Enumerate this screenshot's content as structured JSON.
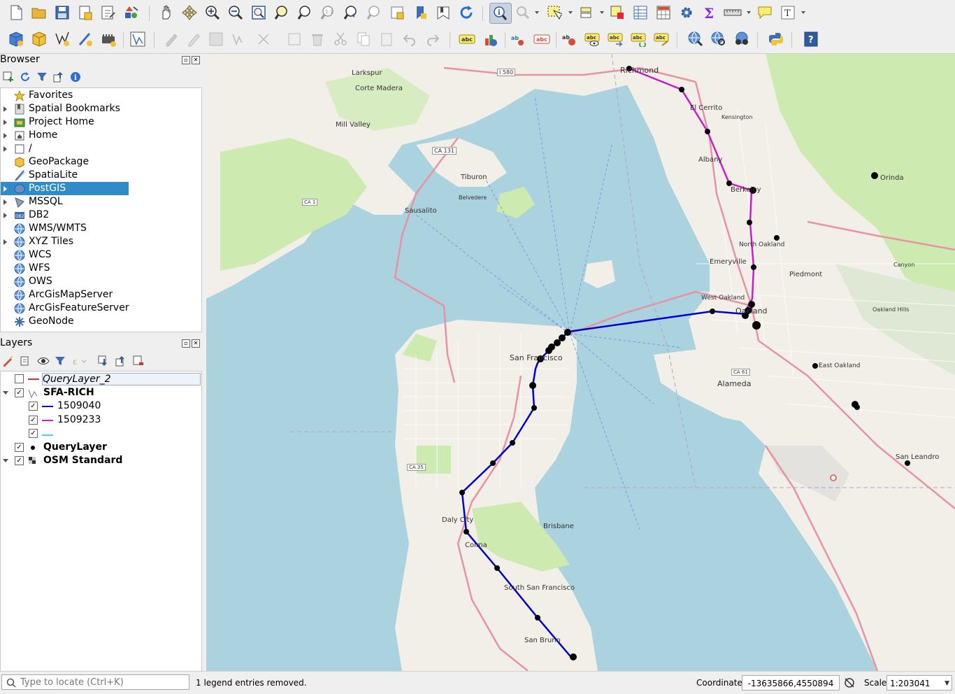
{
  "toolbar_icons": {
    "row1": [
      "new-project-icon",
      "open-project-icon",
      "save-project-icon",
      "new-print-layout-icon",
      "layout-manager-icon",
      "style-manager-icon",
      "pan-icon",
      "pan-to-selection-icon",
      "zoom-in-icon",
      "zoom-out-icon",
      "zoom-full-icon",
      "zoom-to-selection-icon",
      "zoom-to-layer-icon",
      "zoom-native-icon",
      "zoom-last-icon",
      "zoom-next-icon",
      "new-map-view-icon",
      "new-bookmark-icon",
      "show-bookmarks-icon",
      "refresh-icon",
      "identify-icon",
      "map-tips-icon",
      "select-features-icon",
      "select-by-value-icon",
      "deselect-icon",
      "attribute-table-icon",
      "field-calculator-icon",
      "processing-toolbox-icon",
      "statistics-icon",
      "measure-icon",
      "annotation-icon",
      "text-annotation-icon"
    ],
    "row2": [
      "data-source-manager-icon",
      "new-geopackage-layer-icon",
      "new-shapefile-layer-icon",
      "new-spatialite-layer-icon",
      "new-virtual-layer-icon",
      "digitize-icon",
      "current-edits-icon",
      "toggle-editing-icon",
      "save-edits-icon",
      "add-feature-icon",
      "vertex-tool-icon",
      "modify-attributes-icon",
      "delete-selected-icon",
      "cut-features-icon",
      "copy-features-icon",
      "paste-features-icon",
      "undo-icon",
      "redo-icon",
      "label-tool-icon",
      "diagram-icon",
      "pin-label-icon",
      "show-hide-labels-icon",
      "move-label-icon",
      "rotate-label-icon",
      "change-label-icon",
      "label-props-icon",
      "metasearch-icon",
      "wms-icon",
      "coordinate-capture-icon",
      "python-console-icon",
      "help-icon"
    ]
  },
  "browser": {
    "title": "Browser",
    "items": [
      {
        "label": "Favorites",
        "icon": "star-icon",
        "expand": "none"
      },
      {
        "label": "Spatial Bookmarks",
        "icon": "bookmarks-icon",
        "expand": "closed"
      },
      {
        "label": "Project Home",
        "icon": "project-home-icon",
        "expand": "closed"
      },
      {
        "label": "Home",
        "icon": "home-icon",
        "expand": "closed"
      },
      {
        "label": "/",
        "icon": "folder-icon",
        "expand": "closed"
      },
      {
        "label": "GeoPackage",
        "icon": "geopackage-icon",
        "expand": "none"
      },
      {
        "label": "SpatiaLite",
        "icon": "spatialite-icon",
        "expand": "none"
      },
      {
        "label": "PostGIS",
        "icon": "postgis-icon",
        "expand": "closed"
      },
      {
        "label": "MSSQL",
        "icon": "mssql-icon",
        "expand": "closed"
      },
      {
        "label": "DB2",
        "icon": "db2-icon",
        "expand": "closed"
      },
      {
        "label": "WMS/WMTS",
        "icon": "globe-icon",
        "expand": "none"
      },
      {
        "label": "XYZ Tiles",
        "icon": "globe-icon",
        "expand": "closed"
      },
      {
        "label": "WCS",
        "icon": "globe-icon",
        "expand": "none"
      },
      {
        "label": "WFS",
        "icon": "globe-icon",
        "expand": "none"
      },
      {
        "label": "OWS",
        "icon": "globe-icon",
        "expand": "none"
      },
      {
        "label": "ArcGisMapServer",
        "icon": "globe-icon",
        "expand": "none"
      },
      {
        "label": "ArcGisFeatureServer",
        "icon": "globe-icon",
        "expand": "none"
      },
      {
        "label": "GeoNode",
        "icon": "geonode-icon",
        "expand": "none"
      }
    ],
    "selected": "PostGIS"
  },
  "layers": {
    "title": "Layers",
    "items": [
      {
        "label": "QueryLayer_2",
        "checked": false,
        "style": "italic-boxed",
        "symbol": "red-line"
      },
      {
        "label": "SFA-RICH",
        "checked": true,
        "style": "bold",
        "symbol": "line-layer"
      },
      {
        "label": "1509040",
        "checked": true,
        "style": "normal",
        "symbol": "blue-line"
      },
      {
        "label": "1509233",
        "checked": true,
        "style": "normal",
        "symbol": "magenta-line"
      },
      {
        "label": "",
        "checked": true,
        "style": "normal",
        "symbol": "cyan-line"
      },
      {
        "label": "QueryLayer",
        "checked": true,
        "style": "bold",
        "symbol": "black-dot"
      },
      {
        "label": "OSM Standard",
        "checked": true,
        "style": "bold",
        "symbol": "raster-icon"
      }
    ],
    "colors": {
      "blue_route": "#0000cc",
      "magenta_route": "#c81ec8",
      "cyan": "#4fd0e6",
      "red": "#e03030"
    }
  },
  "map": {
    "places": [
      "Richmond",
      "El Cerrito",
      "Kensington",
      "Albany",
      "Berkeley",
      "Orinda",
      "North Oakland",
      "Emeryville",
      "Piedmont",
      "West Oakland",
      "Oakland",
      "Oakland Hills",
      "Larkspur",
      "Corte Madera",
      "Mill Valley",
      "Tiburon",
      "Belvedere",
      "Sausalito",
      "San Francisco",
      "Alameda",
      "East Oakland",
      "San Leandro",
      "Daly City",
      "Colma",
      "Brisbane",
      "South San Francisco",
      "San Bruno",
      "Canyon"
    ],
    "roads": [
      "I 580",
      "CA 131",
      "CA 1",
      "CA 35",
      "CA 61"
    ]
  },
  "status": {
    "search_placeholder": "Type to locate (Ctrl+K)",
    "message": "1 legend entries removed.",
    "coordinate_label": "Coordinate",
    "coordinate_value": "-13635866,4550894",
    "scale_label": "Scale",
    "scale_value": "1:203041"
  }
}
